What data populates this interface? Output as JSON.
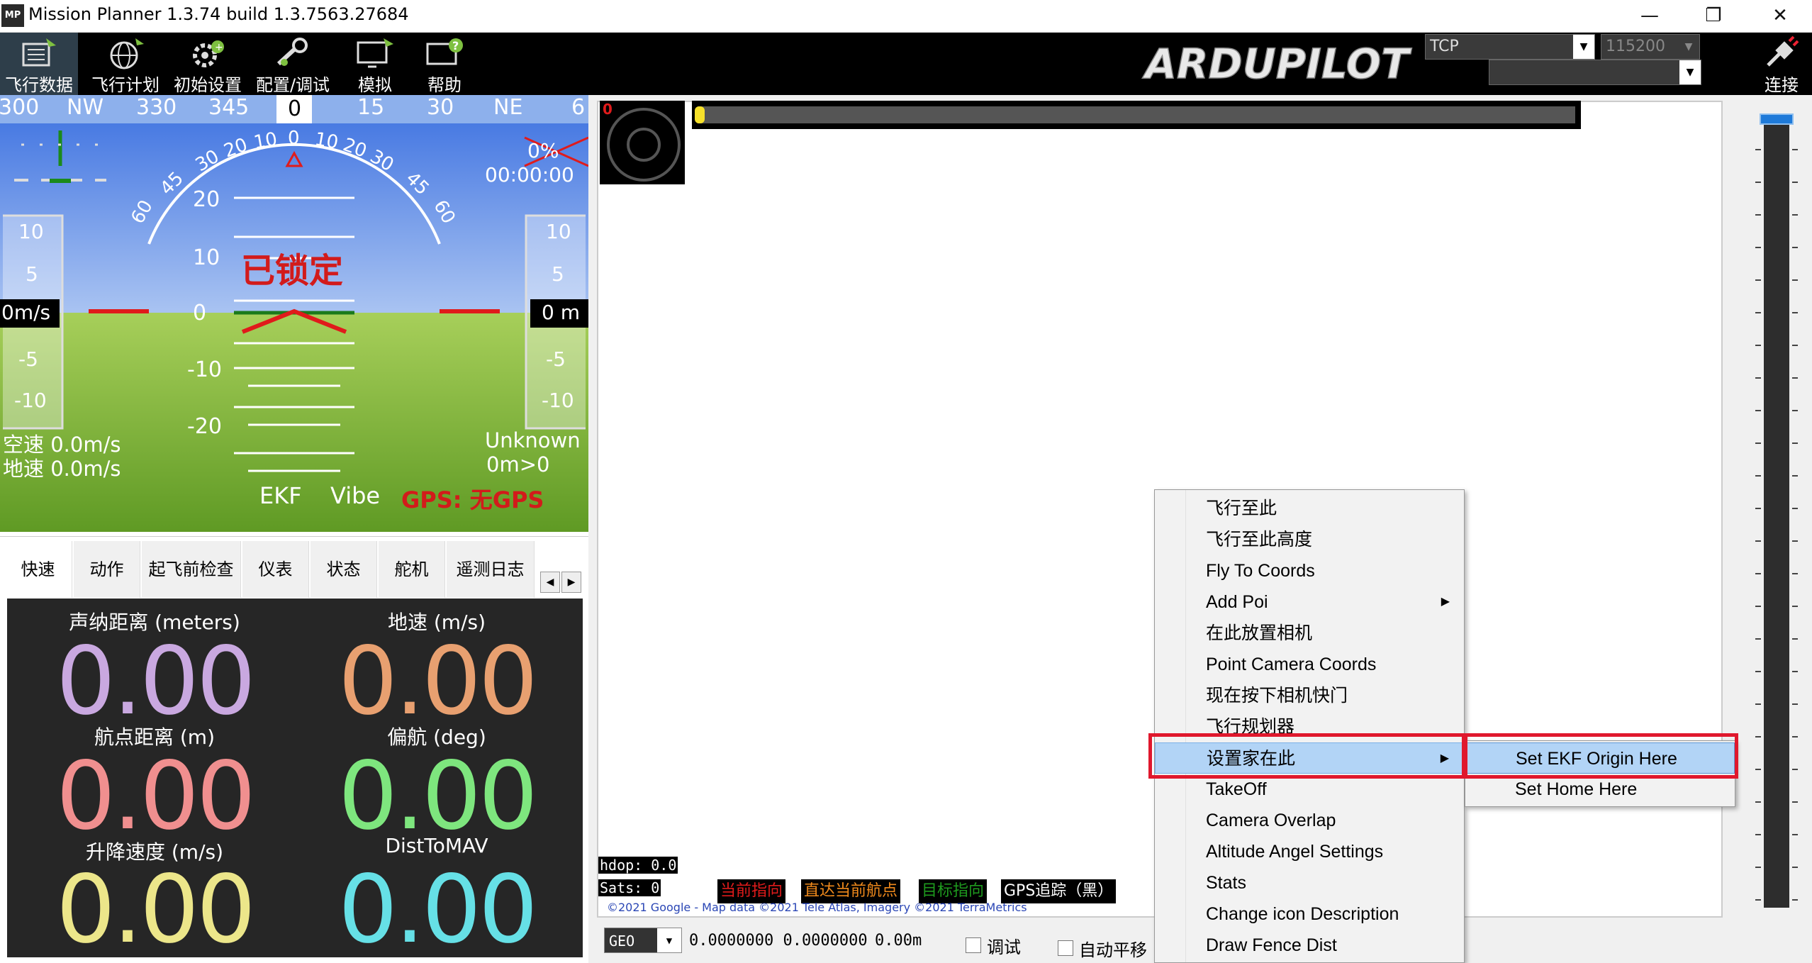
{
  "window": {
    "title": "Mission Planner 1.3.74 build 1.3.7563.27684",
    "icon_text": "MP",
    "minimize": "—",
    "restore": "❐",
    "close": "✕"
  },
  "toolbar": {
    "items": [
      {
        "label": "飞行数据",
        "icon": "flight-data-icon"
      },
      {
        "label": "飞行计划",
        "icon": "globe-icon"
      },
      {
        "label": "初始设置",
        "icon": "setup-icon"
      },
      {
        "label": "配置/调试",
        "icon": "wrench-icon"
      },
      {
        "label": "模拟",
        "icon": "simulation-icon"
      },
      {
        "label": "帮助",
        "icon": "help-icon"
      }
    ],
    "logo": "ARDUPILOT",
    "port": "TCP",
    "baud": "115200",
    "connect_label": "连接"
  },
  "hud": {
    "heading_ticks": [
      "300",
      "NW",
      "330",
      "345",
      "0",
      "15",
      "30",
      "NE",
      "6"
    ],
    "heading_value": "0",
    "pitch_labels": [
      "20",
      "10",
      "0",
      "-10",
      "-20"
    ],
    "roll_labels": [
      "60",
      "45",
      "30",
      "20",
      "10",
      "0",
      "10",
      "20",
      "30",
      "45",
      "60"
    ],
    "armed_text": "已锁定",
    "left_scale": [
      "10",
      "5",
      "-5",
      "-10"
    ],
    "right_scale": [
      "10",
      "5",
      "-5",
      "-10"
    ],
    "speed_box": "0m/s",
    "alt_box": "0 m",
    "battery": "0%",
    "timer": "00:00:00",
    "airspeed": "空速 0.0m/s",
    "groundspeed": "地速 0.0m/s",
    "mode": "Unknown",
    "dist": "0m>0",
    "ekf": "EKF",
    "vibe": "Vibe",
    "gps": "GPS: 无GPS"
  },
  "tabs": {
    "items": [
      "快速",
      "动作",
      "起飞前检查",
      "仪表",
      "状态",
      "舵机",
      "遥测日志"
    ],
    "scroll_left": "◀",
    "scroll_right": "▶"
  },
  "quick": {
    "items": [
      {
        "label": "声纳距离 (meters)",
        "value": "0.00",
        "color": "#c9a8e0"
      },
      {
        "label": "地速 (m/s)",
        "value": "0.00",
        "color": "#e8a070"
      },
      {
        "label": "航点距离 (m)",
        "value": "0.00",
        "color": "#f08f8f"
      },
      {
        "label": "偏航 (deg)",
        "value": "0.00",
        "color": "#7ee67e"
      },
      {
        "label": "升降速度 (m/s)",
        "value": "0.00",
        "color": "#ece68a"
      },
      {
        "label": "DistToMAV",
        "value": "0.00",
        "color": "#66e0e6"
      }
    ]
  },
  "map": {
    "corner_value": "0",
    "hdop": "hdop: 0.0",
    "sats": "Sats: 0",
    "legend": [
      {
        "label": "当前指向",
        "color": "#e01b1b"
      },
      {
        "label": "直达当前航点",
        "color": "#f08a1c"
      },
      {
        "label": "目标指向",
        "color": "#1e9a1e"
      },
      {
        "label": "GPS追踪（黑）",
        "color": "#ffffff"
      }
    ],
    "copyright": "©2021 Google - Map data ©2021 Tele Atlas, Imagery ©2021 TerraMetrics"
  },
  "statusbar": {
    "projection": "GEO",
    "coords": "0.0000000 0.0000000",
    "alt": "0.00m",
    "debug_label": "调试",
    "autopan_label": "自动平移"
  },
  "context_menu": {
    "items": [
      {
        "label": "飞行至此",
        "submenu": false
      },
      {
        "label": "飞行至此高度",
        "submenu": false
      },
      {
        "label": "Fly To Coords",
        "submenu": false
      },
      {
        "label": "Add Poi",
        "submenu": true
      },
      {
        "label": "在此放置相机",
        "submenu": false
      },
      {
        "label": "Point Camera Coords",
        "submenu": false
      },
      {
        "label": "现在按下相机快门",
        "submenu": false
      },
      {
        "label": "飞行规划器",
        "submenu": false
      },
      {
        "label": "设置家在此",
        "submenu": true
      },
      {
        "label": "TakeOff",
        "submenu": false
      },
      {
        "label": "Camera Overlap",
        "submenu": false
      },
      {
        "label": "Altitude Angel Settings",
        "submenu": false
      },
      {
        "label": "Stats",
        "submenu": false
      },
      {
        "label": "Change icon Description",
        "submenu": false
      },
      {
        "label": "Draw Fence Dist",
        "submenu": false
      }
    ],
    "submenu_arrow": "▶",
    "submenu": [
      "Set EKF Origin Here",
      "Set Home Here"
    ]
  }
}
